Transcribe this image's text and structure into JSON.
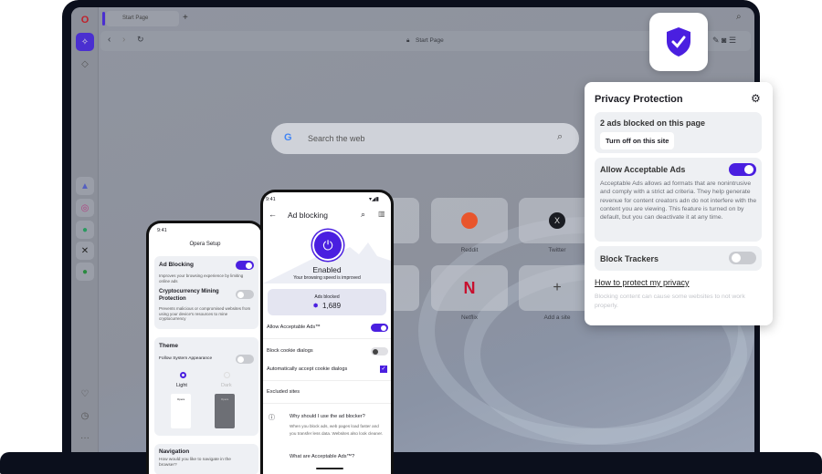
{
  "browser": {
    "tab_title": "Start Page",
    "address": "Start Page",
    "search_placeholder": "Search the web",
    "speed_dials": [
      {
        "label": "Reddit"
      },
      {
        "label": "Twitter"
      },
      {
        "label": "Netflix"
      },
      {
        "label": "Add a site"
      }
    ]
  },
  "popup": {
    "title": "Privacy Protection",
    "ads_blocked": "2 ads blocked on this page",
    "turn_off": "Turn off on this site",
    "acceptable_title": "Allow Acceptable Ads",
    "acceptable_on": true,
    "acceptable_desc": "Acceptable Ads allows ad formats that are nonintrusive and comply with a strict ad criteria. They help generate revenue for content creators adn do not interfere with the content you are viewing. This feature is turned on by default, but you can deactivate it at any time.",
    "trackers_title": "Block Trackers",
    "trackers_on": false,
    "link": "How to protect my privacy",
    "note": "Blocking content can cause some websites to not work properly."
  },
  "phone1": {
    "time": "9:41",
    "title": "Opera Setup",
    "ad_title": "Ad Blocking",
    "ad_desc": "Improves your browsing experience by limiting online ads",
    "crypto_title": "Cryptocurrency Mining Protection",
    "crypto_desc": "Prevents malicious or compromised websites from using your device's resources to mine cryptocurrency",
    "theme_title": "Theme",
    "follow": "Follow System Appearance",
    "light": "Light",
    "dark": "Dark",
    "preview_label": "Opera",
    "nav_title": "Navigation",
    "nav_desc": "How would you like to navigate in the browser?"
  },
  "phone2": {
    "time": "9:41",
    "title": "Ad blocking",
    "status": "Enabled",
    "status_sub": "Your browsing speed is improved",
    "ads_label": "Ads blocked",
    "ads_count": "1,689",
    "acceptable": "Allow Acceptable Ads™",
    "cookie": "Block cookie dialogs",
    "auto_cookie": "Automatically accept cookie dialogs",
    "excluded": "Excluded sites",
    "why_title": "Why should I use the ad blocker?",
    "why_desc": "When you block ads, web pages load faster and you transfer less data. Websites also look cleaner.",
    "what": "What are Acceptable Ads™?"
  },
  "colors": {
    "accent": "#4a1fe0"
  }
}
